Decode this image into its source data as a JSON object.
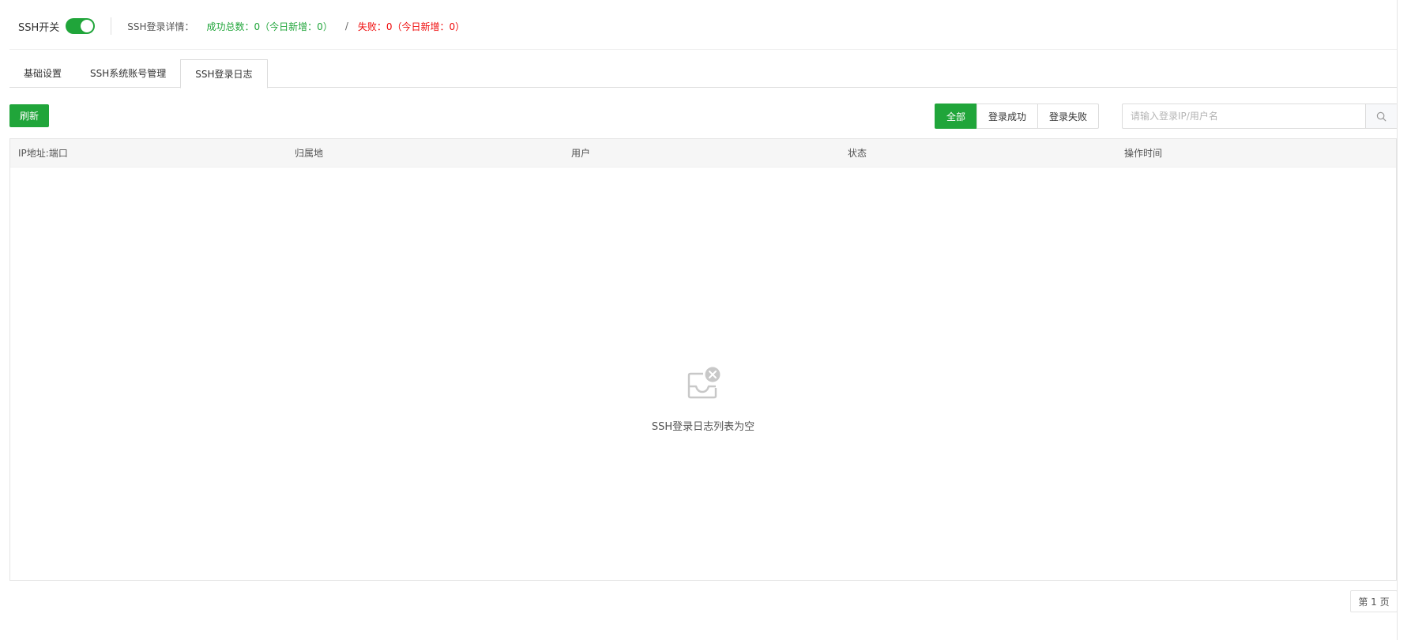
{
  "status": {
    "ssh_switch_label": "SSH开关",
    "ssh_switch_on": true,
    "detail_label": "SSH登录详情：",
    "success_text": "成功总数：0（今日新增：0）",
    "separator": "/",
    "fail_text": "失败：0（今日新增：0）"
  },
  "tabs": [
    {
      "label": "基础设置",
      "active": false
    },
    {
      "label": "SSH系统账号管理",
      "active": false
    },
    {
      "label": "SSH登录日志",
      "active": true
    }
  ],
  "toolbar": {
    "refresh_label": "刷新",
    "filters": [
      {
        "label": "全部",
        "active": true
      },
      {
        "label": "登录成功",
        "active": false
      },
      {
        "label": "登录失败",
        "active": false
      }
    ],
    "search_placeholder": "请输入登录IP/用户名",
    "search_icon": "search-icon"
  },
  "table": {
    "columns": [
      "IP地址:端口",
      "归属地",
      "用户",
      "状态",
      "操作时间"
    ],
    "rows": [],
    "empty_text": "SSH登录日志列表为空",
    "empty_icon": "empty-inbox-icon"
  },
  "pagination": {
    "page_text": "第 1 页"
  },
  "colors": {
    "accent": "#20a53a",
    "fail": "#ef0808"
  }
}
